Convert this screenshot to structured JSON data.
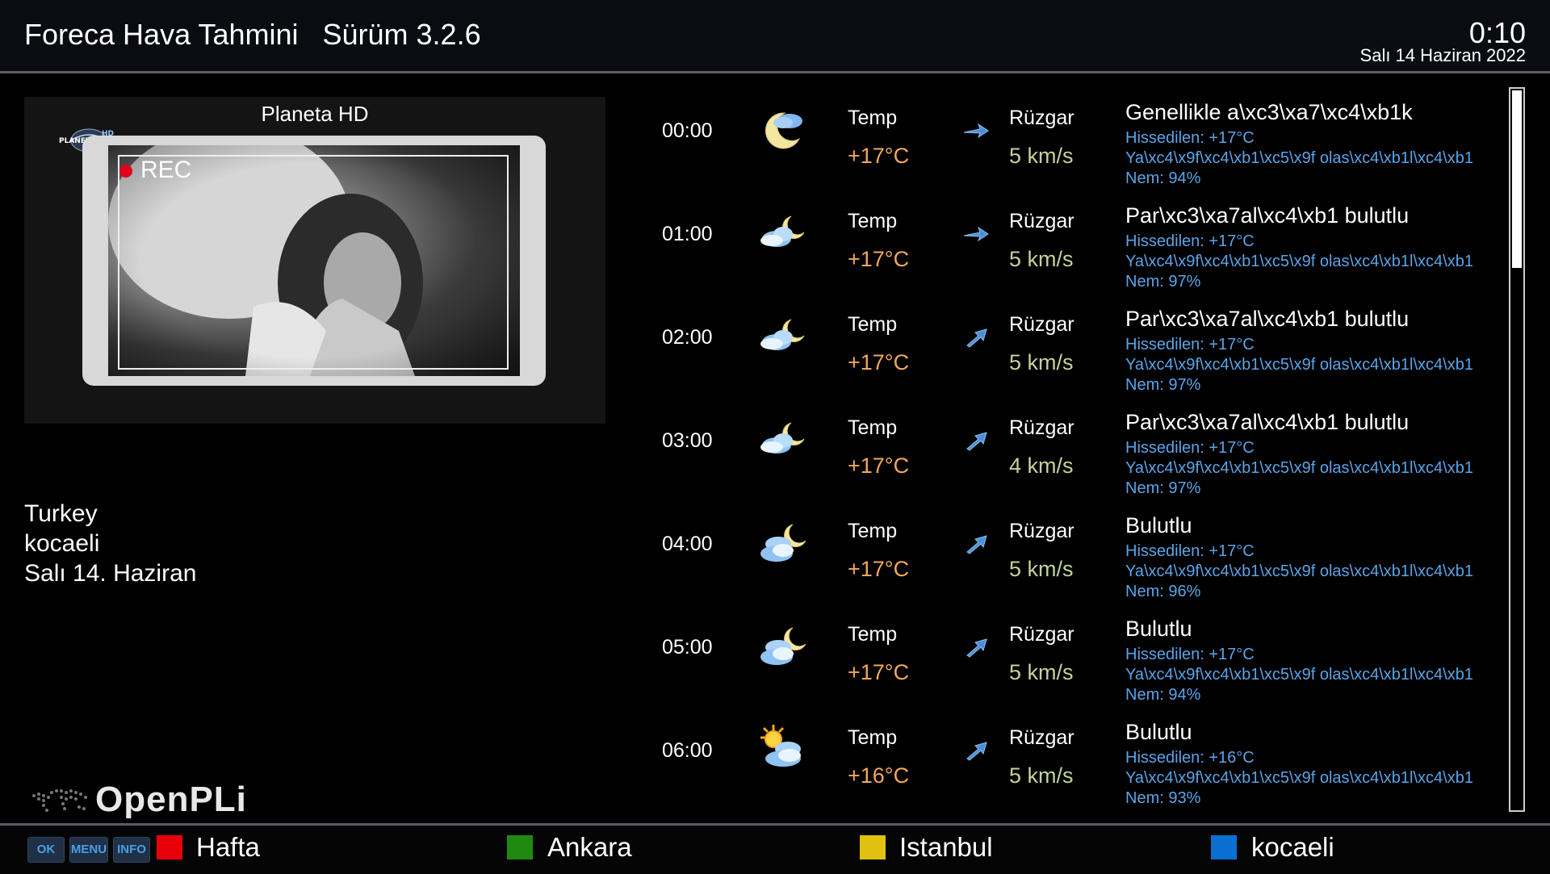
{
  "header": {
    "title": "Foreca Hava Tahmini   Sürüm 3.2.6",
    "clock": "0:10",
    "date": "Salı 14 Haziran 2022"
  },
  "preview": {
    "channel": "Planeta HD",
    "rec_label": "REC",
    "logo_text": "PLANETA HD"
  },
  "location": {
    "country": "Turkey",
    "city": "kocaeli",
    "day": "Salı 14. Haziran"
  },
  "branding": {
    "name": "OpenPLi"
  },
  "forecast": [
    {
      "time": "00:00",
      "icon": "moon-cloud-icon",
      "temp_label": "Temp",
      "temp": "+17°C",
      "wind_label": "Rüzgar",
      "wind": "5 km/s",
      "wind_dir": "east",
      "desc": "Genellikle a\\xc3\\xa7\\xc4\\xb1k",
      "feels": "Hissedilen: +17°C",
      "rain": "Ya\\xc4\\x9f\\xc4\\xb1\\xc5\\x9f olas\\xc4\\xb1l\\xc4\\xb1",
      "humidity": "Nem: 94%"
    },
    {
      "time": "01:00",
      "icon": "cloud-moon-icon",
      "temp_label": "Temp",
      "temp": "+17°C",
      "wind_label": "Rüzgar",
      "wind": "5 km/s",
      "wind_dir": "east",
      "desc": "Par\\xc3\\xa7al\\xc4\\xb1 bulutlu",
      "feels": "Hissedilen: +17°C",
      "rain": "Ya\\xc4\\x9f\\xc4\\xb1\\xc5\\x9f olas\\xc4\\xb1l\\xc4\\xb1",
      "humidity": "Nem: 97%"
    },
    {
      "time": "02:00",
      "icon": "cloud-moon-icon",
      "temp_label": "Temp",
      "temp": "+17°C",
      "wind_label": "Rüzgar",
      "wind": "5 km/s",
      "wind_dir": "northeast",
      "desc": "Par\\xc3\\xa7al\\xc4\\xb1 bulutlu",
      "feels": "Hissedilen: +17°C",
      "rain": "Ya\\xc4\\x9f\\xc4\\xb1\\xc5\\x9f olas\\xc4\\xb1l\\xc4\\xb1",
      "humidity": "Nem: 97%"
    },
    {
      "time": "03:00",
      "icon": "cloud-moon-icon",
      "temp_label": "Temp",
      "temp": "+17°C",
      "wind_label": "Rüzgar",
      "wind": "4 km/s",
      "wind_dir": "northeast",
      "desc": "Par\\xc3\\xa7al\\xc4\\xb1 bulutlu",
      "feels": "Hissedilen: +17°C",
      "rain": "Ya\\xc4\\x9f\\xc4\\xb1\\xc5\\x9f olas\\xc4\\xb1l\\xc4\\xb1",
      "humidity": "Nem: 97%"
    },
    {
      "time": "04:00",
      "icon": "clouds-moon-icon",
      "temp_label": "Temp",
      "temp": "+17°C",
      "wind_label": "Rüzgar",
      "wind": "5 km/s",
      "wind_dir": "northeast",
      "desc": "Bulutlu",
      "feels": "Hissedilen: +17°C",
      "rain": "Ya\\xc4\\x9f\\xc4\\xb1\\xc5\\x9f olas\\xc4\\xb1l\\xc4\\xb1",
      "humidity": "Nem: 96%"
    },
    {
      "time": "05:00",
      "icon": "clouds-moon-icon",
      "temp_label": "Temp",
      "temp": "+17°C",
      "wind_label": "Rüzgar",
      "wind": "5 km/s",
      "wind_dir": "northeast",
      "desc": "Bulutlu",
      "feels": "Hissedilen: +17°C",
      "rain": "Ya\\xc4\\x9f\\xc4\\xb1\\xc5\\x9f olas\\xc4\\xb1l\\xc4\\xb1",
      "humidity": "Nem: 94%"
    },
    {
      "time": "06:00",
      "icon": "sun-clouds-icon",
      "temp_label": "Temp",
      "temp": "+16°C",
      "wind_label": "Rüzgar",
      "wind": "5 km/s",
      "wind_dir": "northeast",
      "desc": "Bulutlu",
      "feels": "Hissedilen: +16°C",
      "rain": "Ya\\xc4\\x9f\\xc4\\xb1\\xc5\\x9f olas\\xc4\\xb1l\\xc4\\xb1",
      "humidity": "Nem: 93%"
    }
  ],
  "footer": {
    "keys": [
      "OK",
      "MENU",
      "INFO"
    ],
    "buttons": [
      {
        "color": "#e8000b",
        "label": "Hafta"
      },
      {
        "color": "#1e8a10",
        "label": "Ankara"
      },
      {
        "color": "#e0c010",
        "label": "Istanbul"
      },
      {
        "color": "#0a6fd0",
        "label": "kocaeli"
      }
    ]
  },
  "colors": {
    "temp_value": "#f0a85a",
    "wind_value": "#c4d29a",
    "detail_text": "#5aa4e8"
  }
}
